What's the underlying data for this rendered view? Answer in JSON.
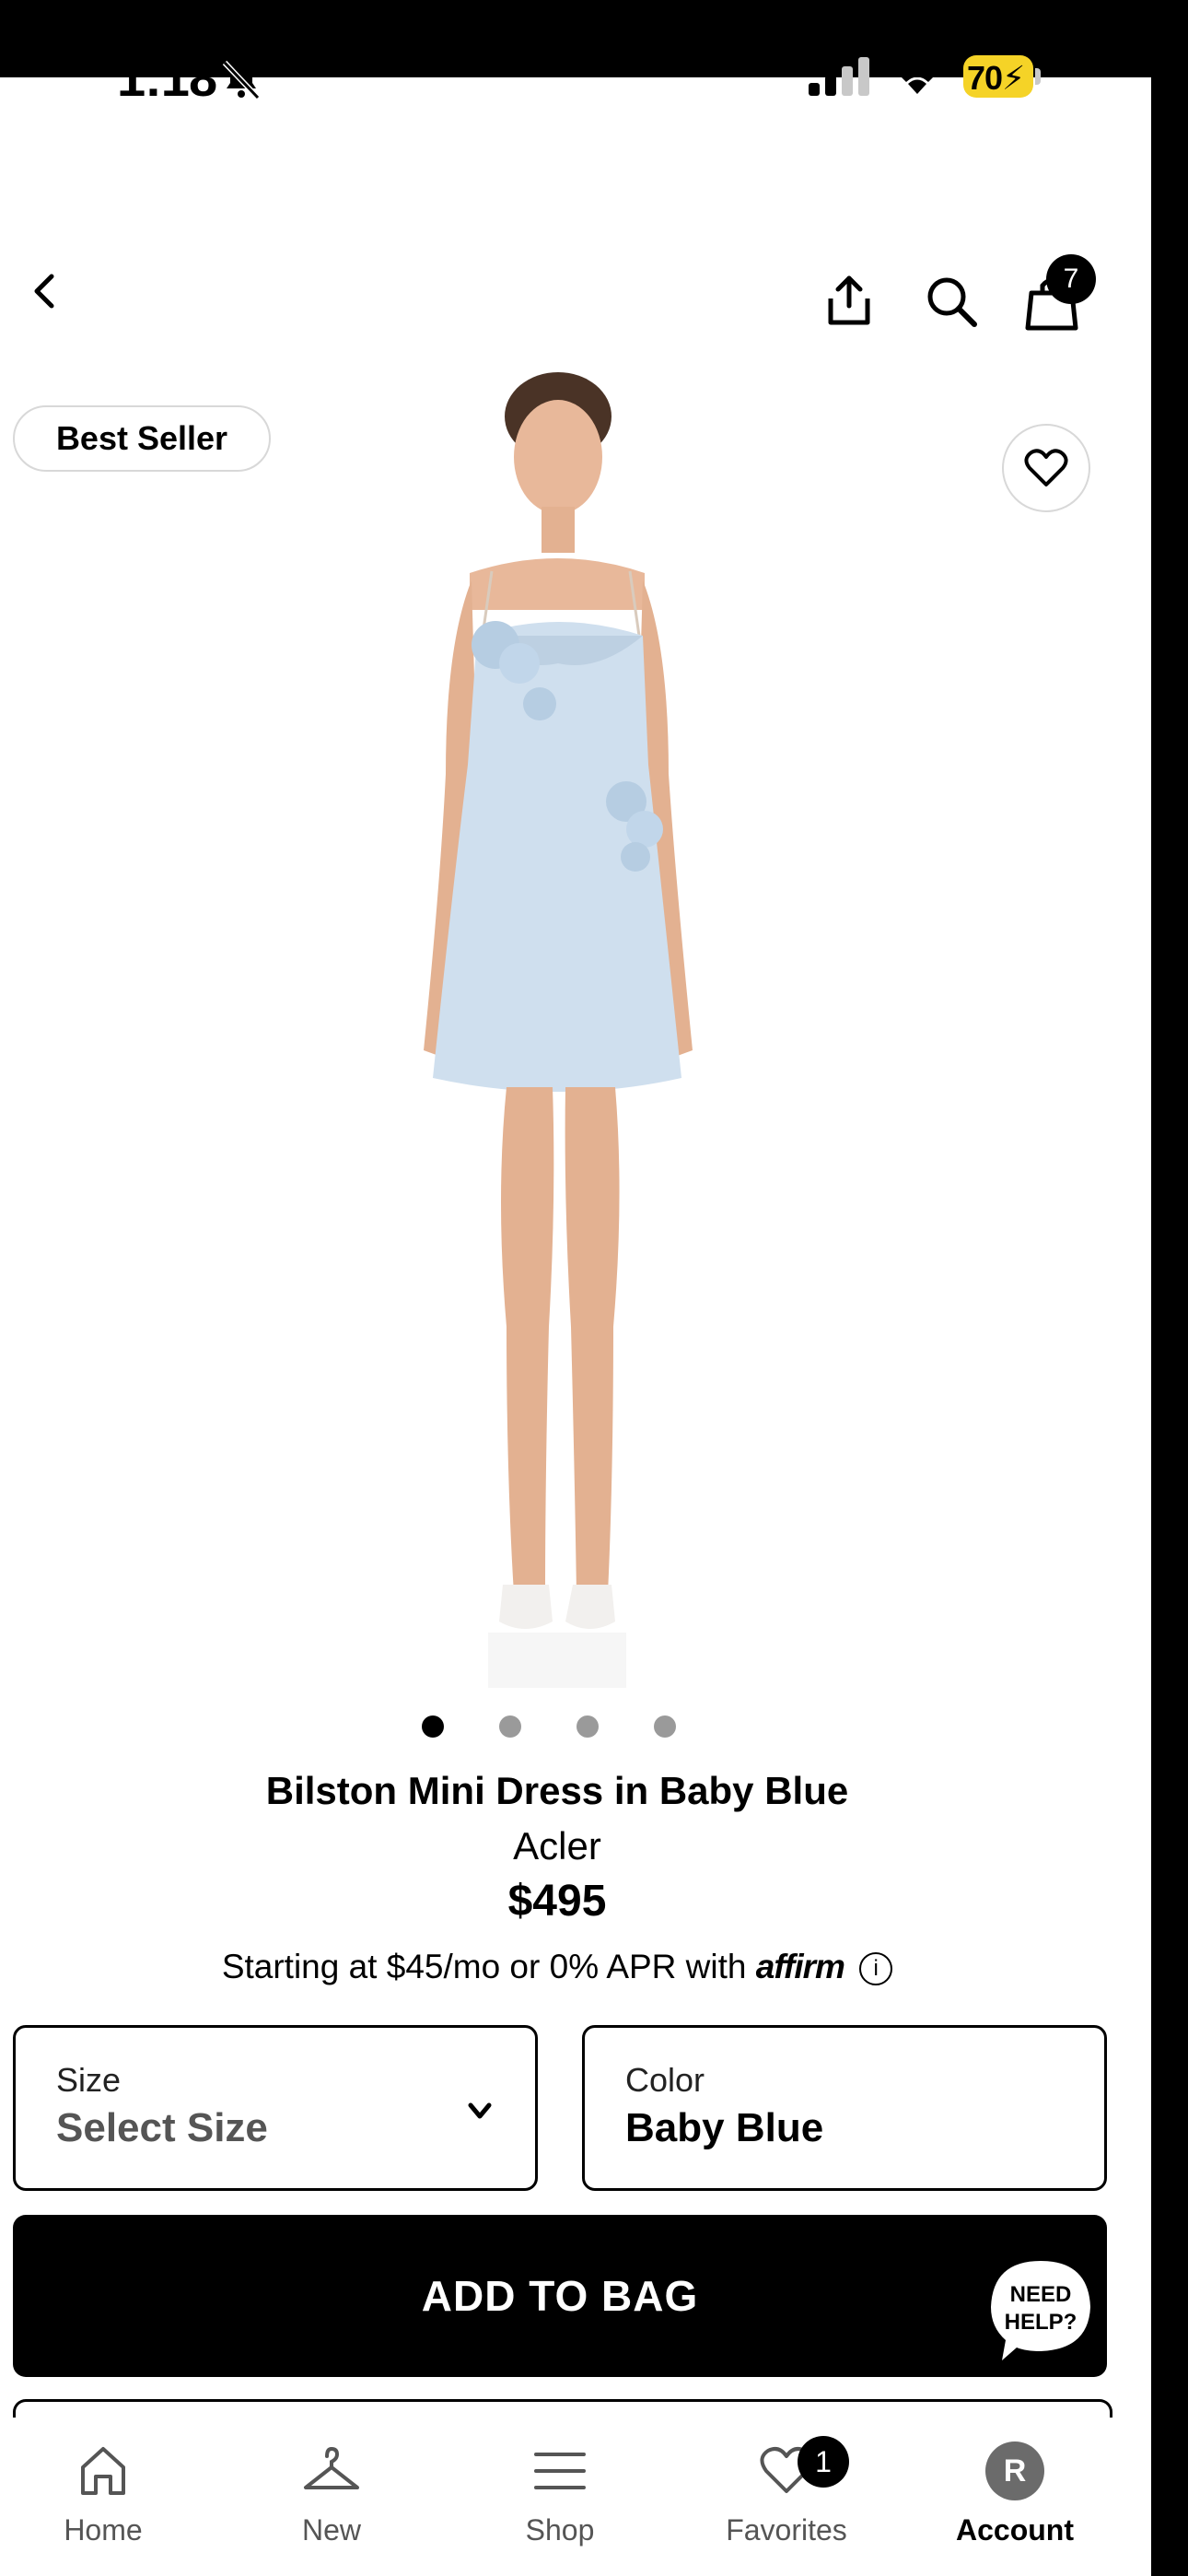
{
  "status_bar": {
    "time": "1:18",
    "battery": "70"
  },
  "nav": {
    "cart_count": "7"
  },
  "product": {
    "badge": "Best Seller",
    "name": "Bilston Mini Dress in Baby Blue",
    "brand": "Acler",
    "price": "$495",
    "financing_text": "Starting at $45/mo or 0% APR with",
    "financing_logo": "affirm",
    "image_count": 4,
    "active_image_index": 0
  },
  "size": {
    "label": "Size",
    "value": "Select Size"
  },
  "color": {
    "label": "Color",
    "value": "Baby Blue"
  },
  "add_to_bag": "ADD TO BAG",
  "help": {
    "line1": "NEED",
    "line2": "HELP?"
  },
  "tabs": [
    {
      "label": "Home",
      "icon": "home-icon"
    },
    {
      "label": "New",
      "icon": "hanger-icon"
    },
    {
      "label": "Shop",
      "icon": "menu-icon"
    },
    {
      "label": "Favorites",
      "icon": "heart-icon",
      "badge": "1"
    },
    {
      "label": "Account",
      "icon": "avatar",
      "initial": "R"
    }
  ]
}
